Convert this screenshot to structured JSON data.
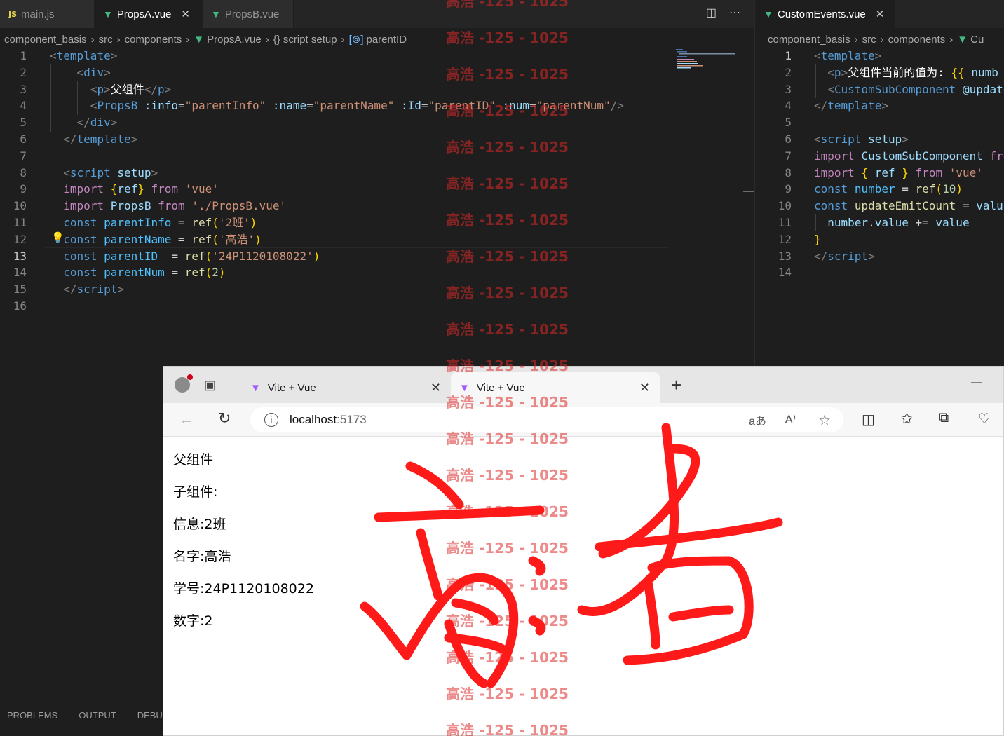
{
  "left_editor": {
    "tabs": [
      {
        "label": "main.js",
        "icon": "js-icon"
      },
      {
        "label": "PropsA.vue",
        "icon": "vue-icon",
        "active": true
      },
      {
        "label": "PropsB.vue",
        "icon": "vue-icon"
      }
    ],
    "breadcrumb": [
      "component_basis",
      "src",
      "components",
      "PropsA.vue",
      "{} script setup",
      "parentID"
    ],
    "cursor_line": 13,
    "lines": [
      [
        [
          "t",
          "<"
        ],
        [
          "tag",
          "template"
        ],
        [
          "t",
          ">"
        ]
      ],
      [
        [
          "pl",
          "    "
        ],
        [
          "t",
          "<"
        ],
        [
          "tag",
          "div"
        ],
        [
          "t",
          ">"
        ]
      ],
      [
        [
          "pl",
          "      "
        ],
        [
          "t",
          "<"
        ],
        [
          "tag",
          "p"
        ],
        [
          "t",
          ">"
        ],
        [
          "zh",
          "父组件"
        ],
        [
          "t",
          "</"
        ],
        [
          "tag",
          "p"
        ],
        [
          "t",
          ">"
        ]
      ],
      [
        [
          "pl",
          "      "
        ],
        [
          "t",
          "<"
        ],
        [
          "tag",
          "PropsB"
        ],
        [
          "pl",
          " "
        ],
        [
          "attr",
          ":info"
        ],
        [
          "pl",
          "="
        ],
        [
          "str",
          "\"parentInfo\""
        ],
        [
          "pl",
          " "
        ],
        [
          "attr",
          ":name"
        ],
        [
          "pl",
          "="
        ],
        [
          "str",
          "\"parentName\""
        ],
        [
          "pl",
          " "
        ],
        [
          "attr",
          ":Id"
        ],
        [
          "pl",
          "="
        ],
        [
          "str",
          "\"parentID\""
        ],
        [
          "pl",
          " "
        ],
        [
          "attr",
          ":num"
        ],
        [
          "pl",
          "="
        ],
        [
          "str",
          "\"parentNum\""
        ],
        [
          "t",
          "/>"
        ]
      ],
      [
        [
          "pl",
          "    "
        ],
        [
          "t",
          "</"
        ],
        [
          "tag",
          "div"
        ],
        [
          "t",
          ">"
        ]
      ],
      [
        [
          "pl",
          "  "
        ],
        [
          "t",
          "</"
        ],
        [
          "tag",
          "template"
        ],
        [
          "t",
          ">"
        ]
      ],
      [],
      [
        [
          "pl",
          "  "
        ],
        [
          "t",
          "<"
        ],
        [
          "tag",
          "script"
        ],
        [
          "pl",
          " "
        ],
        [
          "attr",
          "setup"
        ],
        [
          "t",
          ">"
        ]
      ],
      [
        [
          "pl",
          "  "
        ],
        [
          "imp",
          "import"
        ],
        [
          "pl",
          " "
        ],
        [
          "brk",
          "{"
        ],
        [
          "vr",
          "ref"
        ],
        [
          "brk",
          "}"
        ],
        [
          "pl",
          " "
        ],
        [
          "imp",
          "from"
        ],
        [
          "pl",
          " "
        ],
        [
          "str",
          "'vue'"
        ]
      ],
      [
        [
          "pl",
          "  "
        ],
        [
          "imp",
          "import"
        ],
        [
          "pl",
          " "
        ],
        [
          "vr",
          "PropsB"
        ],
        [
          "pl",
          " "
        ],
        [
          "imp",
          "from"
        ],
        [
          "pl",
          " "
        ],
        [
          "str",
          "'./PropsB.vue'"
        ]
      ],
      [
        [
          "pl",
          "  "
        ],
        [
          "kw",
          "const"
        ],
        [
          "pl",
          " "
        ],
        [
          "var",
          "parentInfo"
        ],
        [
          "pl",
          " = "
        ],
        [
          "fn",
          "ref"
        ],
        [
          "brk",
          "("
        ],
        [
          "str",
          "'2班'"
        ],
        [
          "brk",
          ")"
        ]
      ],
      [
        [
          "pl",
          "  "
        ],
        [
          "kw",
          "const"
        ],
        [
          "pl",
          " "
        ],
        [
          "var",
          "parentName"
        ],
        [
          "pl",
          " = "
        ],
        [
          "fn",
          "ref"
        ],
        [
          "brk",
          "("
        ],
        [
          "str",
          "'高浩'"
        ],
        [
          "brk",
          ")"
        ]
      ],
      [
        [
          "pl",
          "  "
        ],
        [
          "kw",
          "const"
        ],
        [
          "pl",
          " "
        ],
        [
          "var",
          "parentID"
        ],
        [
          "pl",
          "  = "
        ],
        [
          "fn",
          "ref"
        ],
        [
          "brk",
          "("
        ],
        [
          "str",
          "'24P1120108022'"
        ],
        [
          "brk",
          ")"
        ]
      ],
      [
        [
          "pl",
          "  "
        ],
        [
          "kw",
          "const"
        ],
        [
          "pl",
          " "
        ],
        [
          "var",
          "parentNum"
        ],
        [
          "pl",
          " = "
        ],
        [
          "fn",
          "ref"
        ],
        [
          "brk",
          "("
        ],
        [
          "num",
          "2"
        ],
        [
          "brk",
          ")"
        ]
      ],
      [
        [
          "pl",
          "  "
        ],
        [
          "t",
          "</"
        ],
        [
          "tag",
          "script"
        ],
        [
          "t",
          ">"
        ]
      ],
      []
    ]
  },
  "right_editor": {
    "tabs": [
      {
        "label": "CustomEvents.vue",
        "icon": "vue-icon",
        "active": true
      }
    ],
    "breadcrumb": [
      "component_basis",
      "src",
      "components",
      "Cu"
    ],
    "cursor_line": 1,
    "lines": [
      [
        [
          "t",
          "<"
        ],
        [
          "tag",
          "template"
        ],
        [
          "t",
          ">"
        ]
      ],
      [
        [
          "pl",
          "  "
        ],
        [
          "t",
          "<"
        ],
        [
          "tag",
          "p"
        ],
        [
          "t",
          ">"
        ],
        [
          "zh",
          "父组件当前的值为: "
        ],
        [
          "brk",
          "{{"
        ],
        [
          "pl",
          " "
        ],
        [
          "vr",
          "numb"
        ]
      ],
      [
        [
          "pl",
          "  "
        ],
        [
          "t",
          "<"
        ],
        [
          "tag",
          "CustomSubComponent"
        ],
        [
          "pl",
          " "
        ],
        [
          "attr",
          "@update"
        ]
      ],
      [
        [
          "t",
          "</"
        ],
        [
          "tag",
          "template"
        ],
        [
          "t",
          ">"
        ]
      ],
      [],
      [
        [
          "t",
          "<"
        ],
        [
          "tag",
          "script"
        ],
        [
          "pl",
          " "
        ],
        [
          "attr",
          "setup"
        ],
        [
          "t",
          ">"
        ]
      ],
      [
        [
          "imp",
          "import"
        ],
        [
          "pl",
          " "
        ],
        [
          "vr",
          "CustomSubComponent"
        ],
        [
          "pl",
          " "
        ],
        [
          "imp",
          "fro"
        ]
      ],
      [
        [
          "imp",
          "import"
        ],
        [
          "pl",
          " "
        ],
        [
          "brk",
          "{"
        ],
        [
          "pl",
          " "
        ],
        [
          "vr",
          "ref"
        ],
        [
          "pl",
          " "
        ],
        [
          "brk",
          "}"
        ],
        [
          "pl",
          " "
        ],
        [
          "imp",
          "from"
        ],
        [
          "pl",
          " "
        ],
        [
          "str",
          "'vue'"
        ]
      ],
      [
        [
          "kw",
          "const"
        ],
        [
          "pl",
          " "
        ],
        [
          "var",
          "number"
        ],
        [
          "pl",
          " = "
        ],
        [
          "fn",
          "ref"
        ],
        [
          "brk",
          "("
        ],
        [
          "num",
          "10"
        ],
        [
          "brk",
          ")"
        ]
      ],
      [
        [
          "kw",
          "const"
        ],
        [
          "pl",
          " "
        ],
        [
          "fn",
          "updateEmitCount"
        ],
        [
          "pl",
          " = "
        ],
        [
          "vr",
          "valu"
        ]
      ],
      [
        [
          "pl",
          "  "
        ],
        [
          "vr",
          "number"
        ],
        [
          "pl",
          "."
        ],
        [
          "vr",
          "value"
        ],
        [
          "pl",
          " += "
        ],
        [
          "vr",
          "value"
        ]
      ],
      [
        [
          "brk",
          "}"
        ]
      ],
      [
        [
          "t",
          "</"
        ],
        [
          "tag",
          "script"
        ],
        [
          "t",
          ">"
        ]
      ],
      []
    ]
  },
  "panel": {
    "tabs": [
      "PROBLEMS",
      "OUTPUT",
      "DEBUG"
    ]
  },
  "browser": {
    "tabs": [
      {
        "title": "Vite + Vue"
      },
      {
        "title": "Vite + Vue",
        "active": true
      }
    ],
    "url_host": "localhost",
    "url_port": ":5173",
    "content": [
      "父组件",
      "子组件:",
      "信息:2班",
      "名字:高浩",
      "学号:24P1120108022",
      "数字:2"
    ]
  },
  "watermark": {
    "text": "高浩 -125 - 1025",
    "count": 21
  }
}
